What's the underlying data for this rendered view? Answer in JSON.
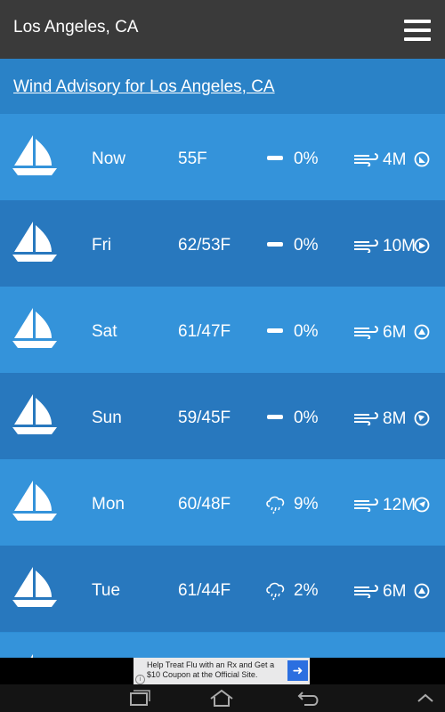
{
  "header": {
    "title": "Los Angeles, CA",
    "menu_icon": "hamburger-menu-icon"
  },
  "advisory": {
    "text": "Wind Advisory for Los Angeles, CA"
  },
  "forecast": [
    {
      "day": "Now",
      "temp": "55F",
      "precip_icon": "dash-icon",
      "precip": "0%",
      "wind": "4M",
      "wind_dir": "southeast"
    },
    {
      "day": "Fri",
      "temp": "62/53F",
      "precip_icon": "dash-icon",
      "precip": "0%",
      "wind": "10M",
      "wind_dir": "east"
    },
    {
      "day": "Sat",
      "temp": "61/47F",
      "precip_icon": "dash-icon",
      "precip": "0%",
      "wind": "6M",
      "wind_dir": "north"
    },
    {
      "day": "Sun",
      "temp": "59/45F",
      "precip_icon": "dash-icon",
      "precip": "0%",
      "wind": "8M",
      "wind_dir": "northwest"
    },
    {
      "day": "Mon",
      "temp": "60/48F",
      "precip_icon": "rain-cloud-icon",
      "precip": "9%",
      "wind": "12M",
      "wind_dir": "northeast"
    },
    {
      "day": "Tue",
      "temp": "61/44F",
      "precip_icon": "rain-cloud-icon",
      "precip": "2%",
      "wind": "6M",
      "wind_dir": "north"
    }
  ],
  "ad": {
    "text": "Help Treat Flu with an Rx and Get a $10 Coupon at the Official Site.",
    "arrow": "➜",
    "info": "i"
  },
  "colors": {
    "topbar": "#3a3a3a",
    "row_dark": "#2878be",
    "row_light": "#3493da",
    "ad_arrow": "#2b6fe0"
  }
}
